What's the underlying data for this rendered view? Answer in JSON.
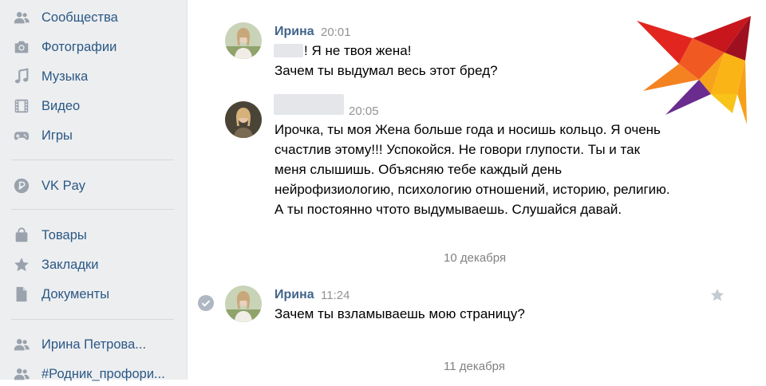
{
  "sidebar": {
    "items": [
      {
        "label": "Сообщества",
        "icon": "people-icon"
      },
      {
        "label": "Фотографии",
        "icon": "camera-icon"
      },
      {
        "label": "Музыка",
        "icon": "music-note-icon"
      },
      {
        "label": "Видео",
        "icon": "film-icon"
      },
      {
        "label": "Игры",
        "icon": "gamepad-icon"
      },
      {
        "label": "VK Pay",
        "icon": "vkpay-icon"
      },
      {
        "label": "Товары",
        "icon": "shopping-bag-icon"
      },
      {
        "label": "Закладки",
        "icon": "star-icon"
      },
      {
        "label": "Документы",
        "icon": "document-icon"
      },
      {
        "label": "Ирина Петрова...",
        "icon": "people-icon"
      },
      {
        "label": "#Родник_профори...",
        "icon": "people-icon"
      }
    ]
  },
  "chat": {
    "messages": [
      {
        "author": "Ирина",
        "time": "20:01",
        "lines": [
          "! Я не твоя жена!",
          "Зачем ты выдумал весь этот бред?"
        ]
      },
      {
        "author": "",
        "time": "20:05",
        "lines": [
          "Ирочка, ты моя Жена больше года и носишь кольцо. Я очень",
          "счастлив этому!!! Успокойся. Не говори глупости. Ты и так",
          "меня слышишь. Объясняю тебе каждый день",
          "нейрофизиологию, психологию отношений, историю, религию.",
          "А ты постоянно чтото выдумываешь. Слушайся давай."
        ]
      },
      {
        "author": "Ирина",
        "time": "11:24",
        "lines": [
          "Зачем ты взламываешь мою страницу?"
        ]
      }
    ],
    "date_separators": [
      "10 декабря",
      "11 декабря"
    ]
  },
  "colors": {
    "sidebar_bg": "#edeef0",
    "link": "#2a5885",
    "author": "#42648b",
    "muted": "#939393",
    "icon": "#99a2ad"
  }
}
